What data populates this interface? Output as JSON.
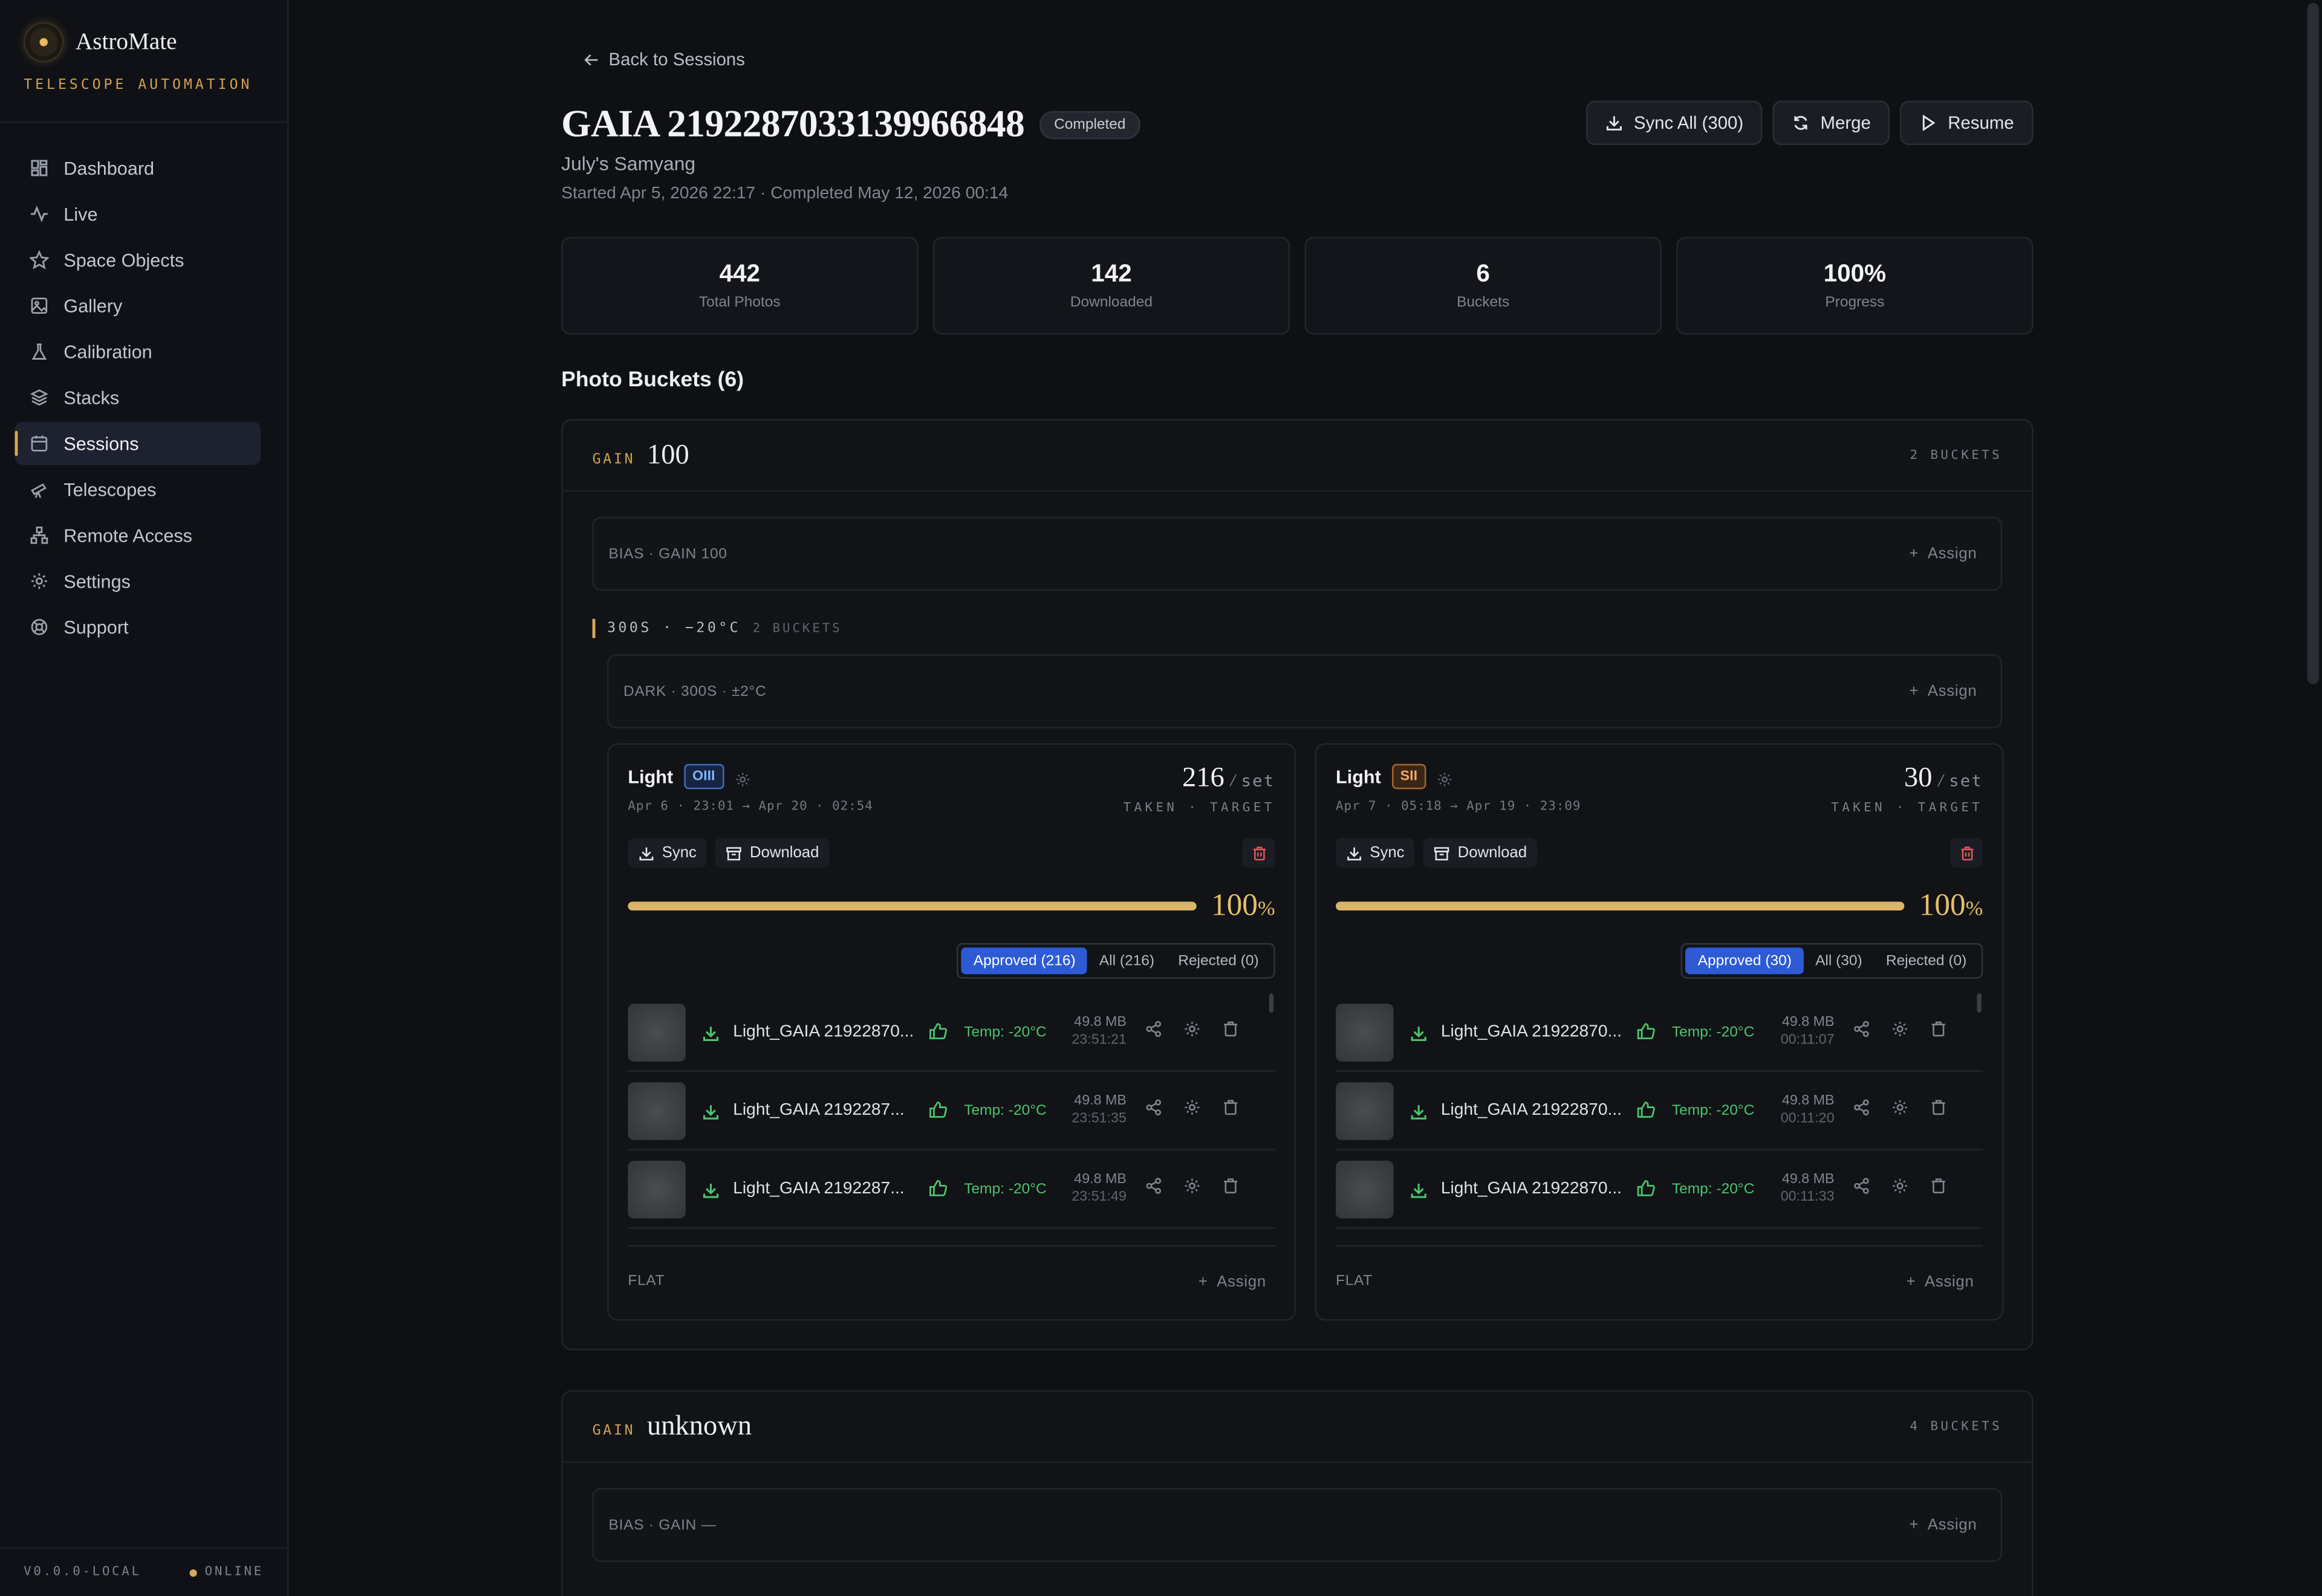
{
  "app": {
    "brand": "AstroMate",
    "tagline": "TELESCOPE AUTOMATION",
    "version": "V0.0.0-LOCAL",
    "status": "ONLINE",
    "accent": "#d8a858"
  },
  "nav": [
    {
      "label": "Dashboard",
      "icon": "dashboard-icon"
    },
    {
      "label": "Live",
      "icon": "activity-icon"
    },
    {
      "label": "Space Objects",
      "icon": "star-icon"
    },
    {
      "label": "Gallery",
      "icon": "image-icon"
    },
    {
      "label": "Calibration",
      "icon": "flask-icon"
    },
    {
      "label": "Stacks",
      "icon": "layers-icon"
    },
    {
      "label": "Sessions",
      "icon": "calendar-icon",
      "active": true
    },
    {
      "label": "Telescopes",
      "icon": "telescope-icon"
    },
    {
      "label": "Remote Access",
      "icon": "network-icon"
    },
    {
      "label": "Settings",
      "icon": "gear-icon"
    },
    {
      "label": "Support",
      "icon": "lifebuoy-icon"
    }
  ],
  "session": {
    "back_label": "Back to Sessions",
    "title": "GAIA 2192287033139966848",
    "status": "Completed",
    "telescope": "July's Samyang",
    "meta": "Started Apr 5, 2026 22:17 · Completed May 12, 2026 00:14",
    "actions": {
      "sync_all": "Sync All (300)",
      "merge": "Merge",
      "resume": "Resume"
    },
    "stats": [
      {
        "value": "442",
        "label": "Total Photos"
      },
      {
        "value": "142",
        "label": "Downloaded"
      },
      {
        "value": "6",
        "label": "Buckets"
      },
      {
        "value": "100%",
        "label": "Progress"
      }
    ],
    "buckets_title": "Photo Buckets (6)"
  },
  "gains": [
    {
      "key": "GAIN",
      "value": "100",
      "count": "2 BUCKETS",
      "bias": "BIAS · GAIN 100",
      "exposure": {
        "label": "300S · −20°C",
        "count": "2 BUCKETS"
      },
      "dark": "DARK · 300S · ±2°C",
      "assign_label": "Assign",
      "lights": [
        {
          "type": "Light",
          "filter": "OIII",
          "dates": "Apr 6 · 23:01 → Apr 20 · 02:54",
          "taken": "216",
          "slash": "/",
          "target": "set",
          "sub": "TAKEN · TARGET",
          "sync": "Sync",
          "download": "Download",
          "progress": 100,
          "progress_label": "100",
          "tabs": [
            "Approved (216)",
            "All (216)",
            "Rejected (0)"
          ],
          "photos": [
            {
              "name": "Light_GAIA 21922870...",
              "temp": "Temp: -20°C",
              "size": "49.8 MB",
              "time": "23:51:21"
            },
            {
              "name": "Light_GAIA 2192287...",
              "temp": "Temp: -20°C",
              "size": "49.8 MB",
              "time": "23:51:35"
            },
            {
              "name": "Light_GAIA 2192287...",
              "temp": "Temp: -20°C",
              "size": "49.8 MB",
              "time": "23:51:49"
            }
          ],
          "flat": "FLAT"
        },
        {
          "type": "Light",
          "filter": "SII",
          "dates": "Apr 7 · 05:18 → Apr 19 · 23:09",
          "taken": "30",
          "slash": "/",
          "target": "set",
          "sub": "TAKEN · TARGET",
          "sync": "Sync",
          "download": "Download",
          "progress": 100,
          "progress_label": "100",
          "tabs": [
            "Approved (30)",
            "All (30)",
            "Rejected (0)"
          ],
          "photos": [
            {
              "name": "Light_GAIA 21922870...",
              "temp": "Temp: -20°C",
              "size": "49.8 MB",
              "time": "00:11:07"
            },
            {
              "name": "Light_GAIA 21922870...",
              "temp": "Temp: -20°C",
              "size": "49.8 MB",
              "time": "00:11:20"
            },
            {
              "name": "Light_GAIA 21922870...",
              "temp": "Temp: -20°C",
              "size": "49.8 MB",
              "time": "00:11:33"
            }
          ],
          "flat": "FLAT"
        }
      ]
    },
    {
      "key": "GAIN",
      "value": "unknown",
      "count": "4 BUCKETS",
      "bias": "BIAS · GAIN —",
      "assign_label": "Assign"
    }
  ]
}
